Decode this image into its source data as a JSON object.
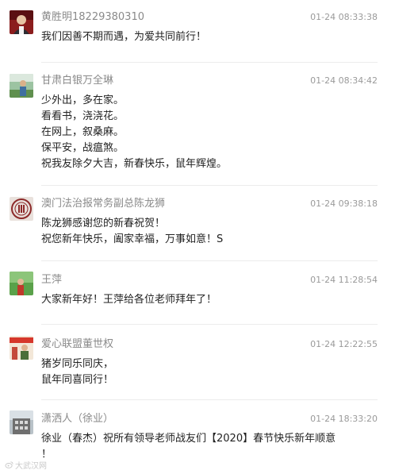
{
  "comments": [
    {
      "name": "黄胜明18229380310",
      "time": "01-24 08:33:38",
      "avatar_icon": "user-avatar-red-photo",
      "lines": [
        "我们因善不期而遇，为爱共同前行！"
      ]
    },
    {
      "name": "甘肃白银万全琳",
      "time": "01-24 08:34:42",
      "avatar_icon": "user-avatar-outdoor-photo",
      "lines": [
        "少外出，多在家。",
        "看看书，浇浇花。",
        "在网上，叙桑麻。",
        "保平安，战瘟煞。",
        "祝我友除夕大吉，新春快乐，鼠年辉煌。"
      ]
    },
    {
      "name": "澳门法治报常务副总陈龙狮",
      "time": "01-24 09:38:18",
      "avatar_icon": "user-avatar-seal-logo",
      "lines": [
        "陈龙狮感谢您的新春祝贺！",
        "祝您新年快乐，阖家幸福，万事如意！S"
      ]
    },
    {
      "name": "王萍",
      "time": "01-24 11:28:54",
      "avatar_icon": "user-avatar-green-photo",
      "lines": [
        "大家新年好！王萍给各位老师拜年了！"
      ]
    },
    {
      "name": "爱心联盟董世权",
      "time": "01-24 12:22:55",
      "avatar_icon": "user-avatar-banner-photo",
      "lines": [
        "猪岁同乐同庆，",
        "鼠年同喜同行！"
      ]
    },
    {
      "name": "潇洒人（徐业）",
      "time": "01-24 18:33:20",
      "avatar_icon": "user-avatar-building-photo",
      "lines": [
        "徐业（春杰）祝所有领导老师战友们【2020】春节快乐新年顺意",
        "！"
      ]
    }
  ],
  "watermark": {
    "icon": "weibo-icon",
    "text": "大武汉网"
  },
  "colors": {
    "name": "#8a8a8a",
    "time": "#9a9a9a",
    "text": "#222222",
    "divider": "#ececec"
  }
}
